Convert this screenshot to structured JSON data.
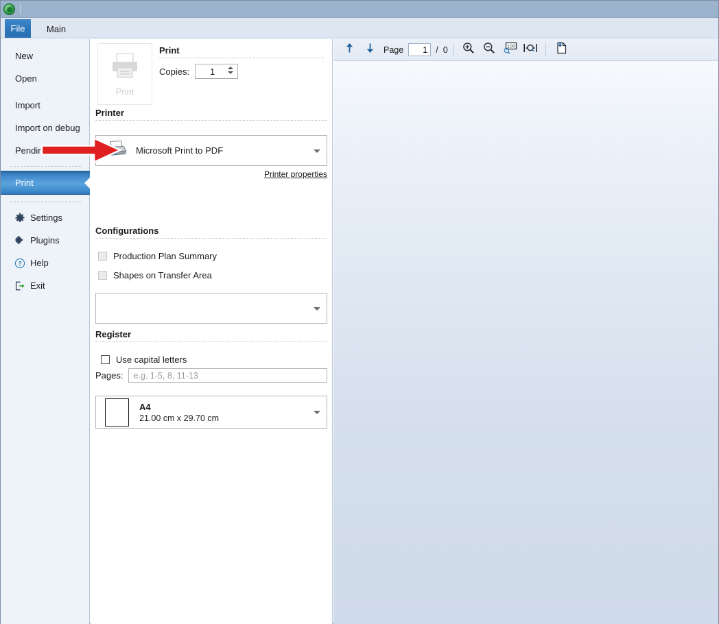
{
  "window": {
    "app_icon": "globe-icon",
    "title": ""
  },
  "ribbon": {
    "tabs": [
      {
        "label": "File",
        "selected": true
      },
      {
        "label": "Main",
        "selected": false
      }
    ]
  },
  "sidebar": {
    "items": [
      {
        "label": "New",
        "icon": null,
        "selected": false
      },
      {
        "label": "Open",
        "icon": null,
        "selected": false
      },
      {
        "label": "Import",
        "icon": null,
        "selected": false
      },
      {
        "label": "Import on debug",
        "icon": null,
        "selected": false
      },
      {
        "label": "Pending Imports",
        "icon": null,
        "selected": false
      },
      {
        "label": "Print",
        "icon": null,
        "selected": true
      },
      {
        "label": "Settings",
        "icon": "gear-icon",
        "selected": false
      },
      {
        "label": "Plugins",
        "icon": "puzzle-icon",
        "selected": false
      },
      {
        "label": "Help",
        "icon": "question-circle-icon",
        "selected": false
      },
      {
        "label": "Exit",
        "icon": "exit-icon",
        "selected": false
      }
    ]
  },
  "print_panel": {
    "print_button": {
      "label": "Print",
      "icon": "printer-icon",
      "disabled": true
    },
    "section_print": {
      "title": "Print"
    },
    "copies": {
      "label": "Copies:",
      "value": "1"
    },
    "section_printer": {
      "title": "Printer"
    },
    "printer": {
      "name": "Microsoft Print to PDF",
      "icon": "printer-icon"
    },
    "printer_properties_link": "Printer properties",
    "section_configurations": {
      "title": "Configurations"
    },
    "configurations": [
      {
        "label": "Production Plan Summary",
        "checked": false,
        "disabled": true
      },
      {
        "label": "Shapes on Transfer Area",
        "checked": false,
        "disabled": true
      }
    ],
    "configuration_select": {
      "value": ""
    },
    "section_register": {
      "title": "Register"
    },
    "register": {
      "use_capital_letters": {
        "label": "Use capital letters",
        "checked": false
      },
      "pages": {
        "label": "Pages:",
        "value": "",
        "placeholder": "e.g. 1-5, 8, 11-13"
      }
    },
    "paper": {
      "name": "A4",
      "dimensions": "21.00 cm x 29.70 cm"
    }
  },
  "preview_toolbar": {
    "previous_page": {
      "icon": "arrow-up-icon"
    },
    "next_page": {
      "icon": "arrow-down-icon"
    },
    "page_label": "Page",
    "page_value": "1",
    "page_separator": "/",
    "page_total": "0",
    "zoom_in": {
      "icon": "zoom-in-icon"
    },
    "zoom_out": {
      "icon": "zoom-out-icon"
    },
    "zoom_100": {
      "icon": "zoom-100-icon",
      "label": "100"
    },
    "fit_page": {
      "icon": "fit-page-icon"
    },
    "export": {
      "icon": "export-page-icon"
    }
  },
  "annotation": {
    "arrow": {
      "color": "#e02020",
      "direction": "right",
      "points_at": "printer-combobox"
    }
  }
}
